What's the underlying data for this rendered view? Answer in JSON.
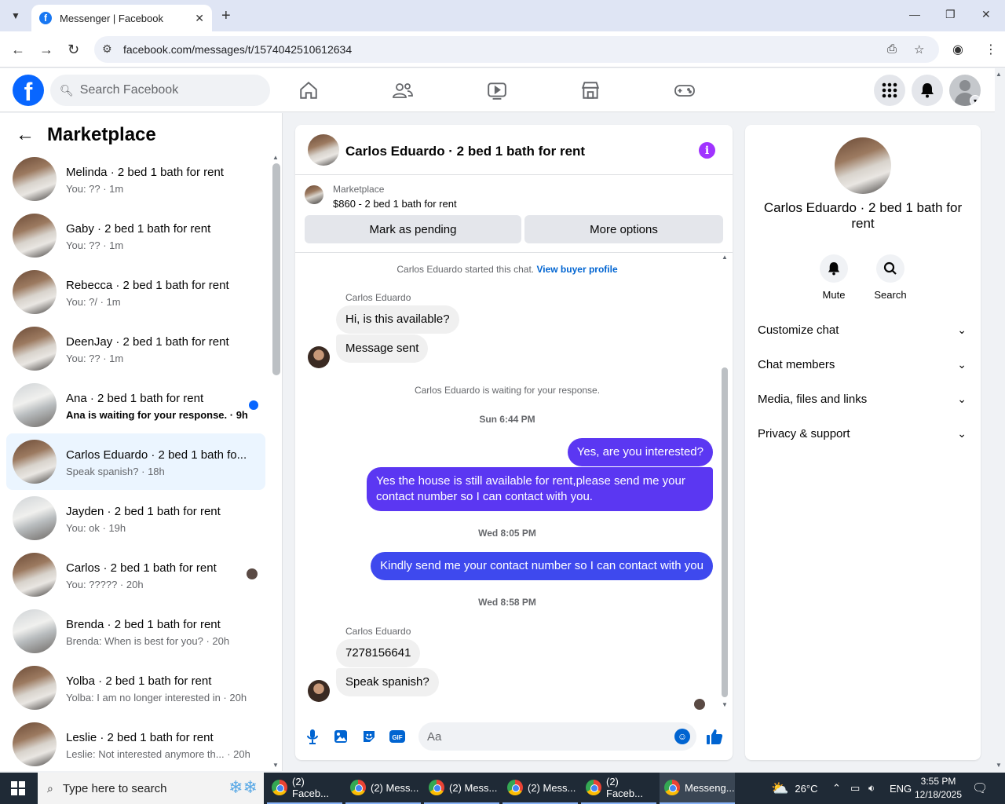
{
  "browser": {
    "tab_title": "Messenger | Facebook",
    "tab_favicon": "f",
    "url": "facebook.com/messages/t/1574042510612634"
  },
  "fb": {
    "logo": "f",
    "search_placeholder": "Search Facebook"
  },
  "sidebar": {
    "title": "Marketplace",
    "conversations": [
      {
        "name": "Melinda · 2 bed 1 bath for rent",
        "sub": "You: ?? · 1m"
      },
      {
        "name": "Gaby · 2 bed 1 bath for rent",
        "sub": "You: ?? · 1m"
      },
      {
        "name": "Rebecca · 2 bed 1 bath for rent",
        "sub": "You: ?/ · 1m"
      },
      {
        "name": "DeenJay · 2 bed 1 bath for rent",
        "sub": "You: ?? · 1m"
      },
      {
        "name": "Ana · 2 bed 1 bath for rent",
        "sub": "Ana is waiting for your response. · 9h",
        "unread": true
      },
      {
        "name": "Carlos Eduardo · 2 bed 1 bath fo...",
        "sub": "Speak spanish? · 18h",
        "active": true
      },
      {
        "name": "Jayden · 2 bed 1 bath for rent",
        "sub": "You: ok · 19h"
      },
      {
        "name": "Carlos · 2 bed 1 bath for rent",
        "sub": "You: ????? · 20h"
      },
      {
        "name": "Brenda · 2 bed 1 bath for rent",
        "sub": "Brenda: When is best for you? · 20h"
      },
      {
        "name": "Yolba · 2 bed 1 bath for rent",
        "sub": "Yolba: I am no longer interested in · 20h"
      },
      {
        "name": "Leslie · 2 bed 1 bath for rent",
        "sub": "Leslie: Not interested anymore th...  · 20h"
      }
    ]
  },
  "chat": {
    "title": "Carlos Eduardo · 2 bed 1 bath for rent",
    "marketplace_label": "Marketplace",
    "listing": "$860 - 2 bed 1 bath for rent",
    "mark_pending": "Mark as pending",
    "more_options": "More options",
    "started_text": "Carlos Eduardo started this chat.",
    "view_profile": "View buyer profile",
    "sender": "Carlos Eduardo",
    "msg1": "Hi, is this available?",
    "msg2": "Message sent",
    "waiting": "Carlos Eduardo is waiting for your response.",
    "time1": "Sun 6:44 PM",
    "out1": "Yes, are you interested?",
    "out2": "Yes the house is still available for rent,please send me your contact number so I can contact with you.",
    "time2": "Wed 8:05 PM",
    "out3": "Kindly send me your contact number so I can contact with you",
    "time3": "Wed 8:58 PM",
    "sender2": "Carlos Eduardo",
    "msg3": "7278156641",
    "msg4": "Speak spanish?",
    "composer_placeholder": "Aa",
    "accent_color": "#5b37f2"
  },
  "right_panel": {
    "name": "Carlos Eduardo · 2 bed 1 bath for rent",
    "mute": "Mute",
    "search": "Search",
    "sections": [
      "Customize chat",
      "Chat members",
      "Media, files and links",
      "Privacy & support"
    ]
  },
  "taskbar": {
    "search_placeholder": "Type here to search",
    "apps": [
      "(2) Faceb...",
      "(2) Mess...",
      "(2) Mess...",
      "(2) Mess...",
      "(2) Faceb...",
      "Messeng..."
    ],
    "weather": "26°C",
    "lang": "ENG",
    "time": "3:55 PM",
    "date": "12/18/2025"
  }
}
